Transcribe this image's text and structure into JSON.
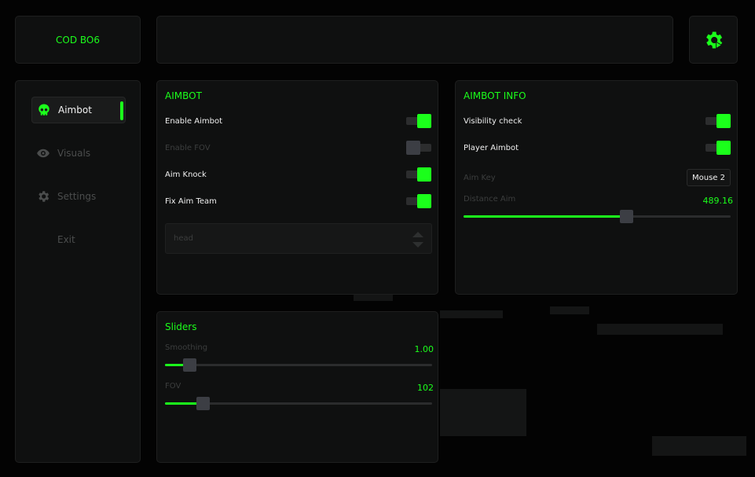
{
  "brand": {
    "title": "COD BO6"
  },
  "colors": {
    "accent": "#1bff1b",
    "panel": "#0f1010",
    "background": "#030303"
  },
  "sidebar": {
    "items": [
      {
        "label": "Aimbot",
        "icon": "skull-icon",
        "active": true
      },
      {
        "label": "Visuals",
        "icon": "eye-icon",
        "active": false
      },
      {
        "label": "Settings",
        "icon": "gear-icon",
        "active": false
      },
      {
        "label": "Exit",
        "icon": "",
        "active": false
      }
    ]
  },
  "aimbot": {
    "title": "AIMBOT",
    "options": [
      {
        "label": "Enable Aimbot",
        "enabled": true,
        "disabled": false
      },
      {
        "label": "Enable FOV",
        "enabled": false,
        "disabled": true
      },
      {
        "label": "Aim Knock",
        "enabled": true,
        "disabled": false
      },
      {
        "label": "Fix Aim Team",
        "enabled": true,
        "disabled": false
      }
    ],
    "target_select": {
      "value": "head"
    }
  },
  "aimbot_info": {
    "title": "AIMBOT INFO",
    "options": [
      {
        "label": "Visibility check",
        "enabled": true
      },
      {
        "label": "Player Aimbot",
        "enabled": true
      }
    ],
    "aim_key": {
      "label": "Aim Key",
      "value": "Mouse 2"
    },
    "distance": {
      "label": "Distance Aim",
      "value_text": "489.16",
      "fraction": 0.61
    }
  },
  "sliders": {
    "title": "Sliders",
    "items": [
      {
        "label": "Smoothing",
        "value_text": "1.00",
        "fraction": 0.09
      },
      {
        "label": "FOV",
        "value_text": "102",
        "fraction": 0.14
      }
    ]
  }
}
